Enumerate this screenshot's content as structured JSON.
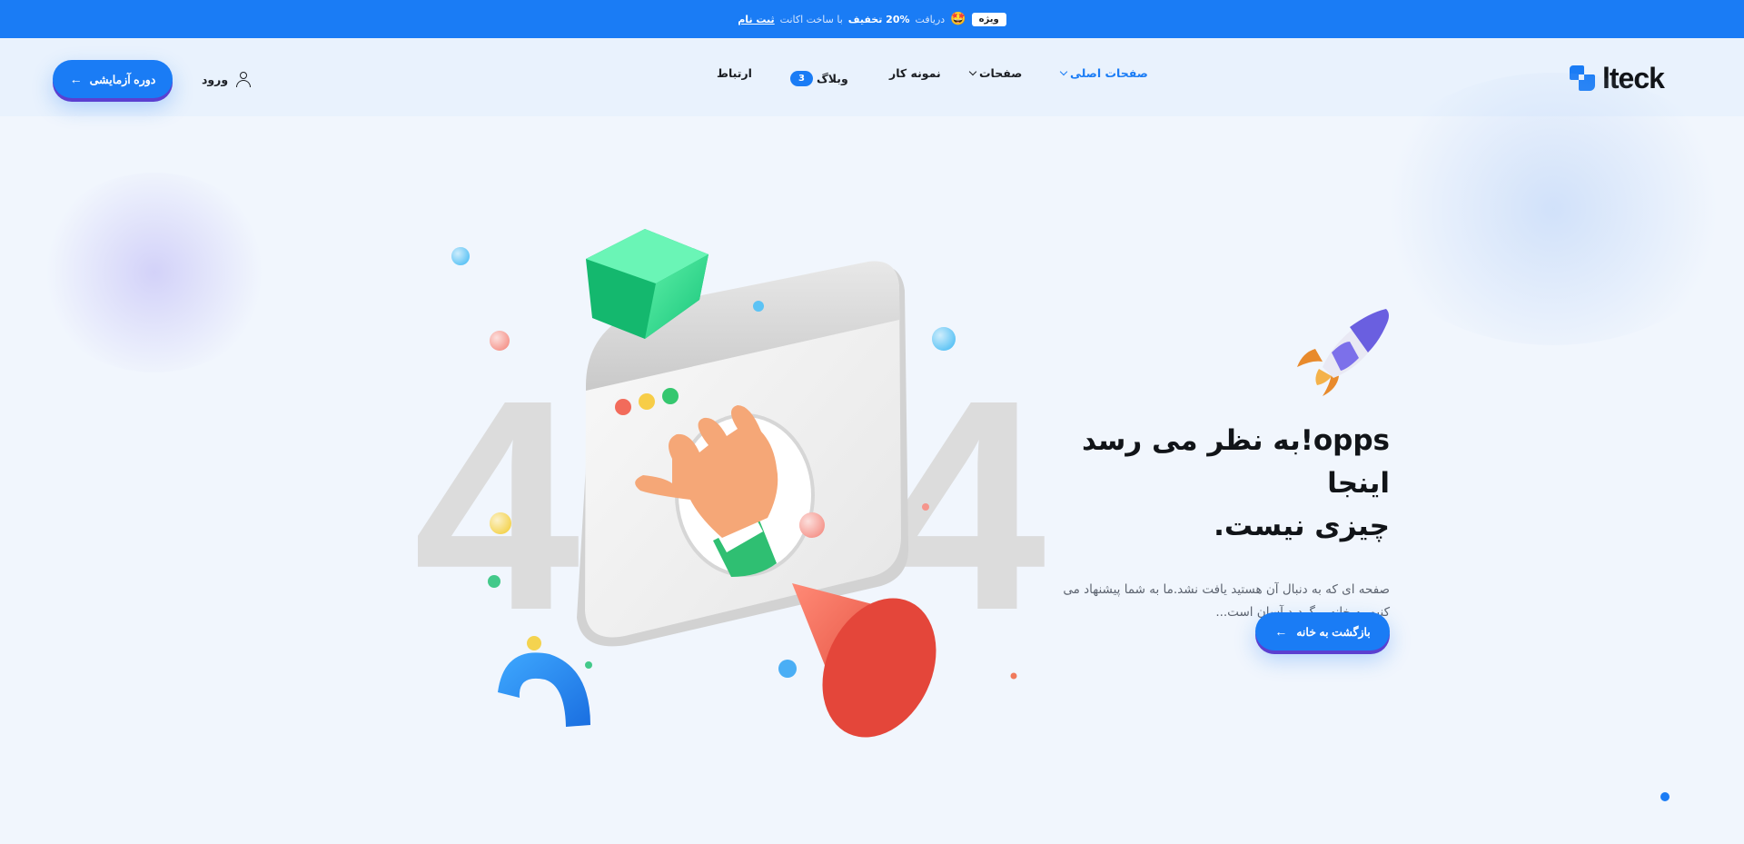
{
  "topbar": {
    "badge": "ویژه",
    "emoji": "🤩",
    "prefix": "دریافت",
    "discount": "20% تخفیف",
    "middle": "با ساخت اکانت",
    "link": "ثبت نام"
  },
  "header": {
    "logo_text": "lteck",
    "nav": [
      {
        "label": "صفحات اصلی",
        "has_dropdown": true,
        "active": true
      },
      {
        "label": "صفحات",
        "has_dropdown": true,
        "active": false
      },
      {
        "label": "نمونه کار",
        "has_dropdown": false,
        "active": false
      },
      {
        "label": "وبلاگ",
        "badge": "3",
        "has_dropdown": false,
        "active": false
      },
      {
        "label": "ارتباط",
        "has_dropdown": false,
        "active": false
      }
    ],
    "login_label": "ورود",
    "trial_button": "دوره آزمایشی"
  },
  "illustration": {
    "digit_left": "4",
    "digit_right": "4"
  },
  "hero": {
    "title_line1": "opps!به نظر می رسد اینجا",
    "title_line2": "چیزی نیست.",
    "description": "صفحه ای که به دنبال آن هستید یافت نشد.ما به شما پیشنهاد می کنیم به خانه برگردید.آسان است...",
    "home_button": "بازگشت به خانه"
  },
  "colors": {
    "accent": "#1a7cf5",
    "button_shadow": "#5b3fd0",
    "background": "#f1f6fd"
  },
  "icons": [
    "logo-icon",
    "chevron-down-icon",
    "user-icon",
    "arrow-left-icon",
    "rocket-icon"
  ]
}
